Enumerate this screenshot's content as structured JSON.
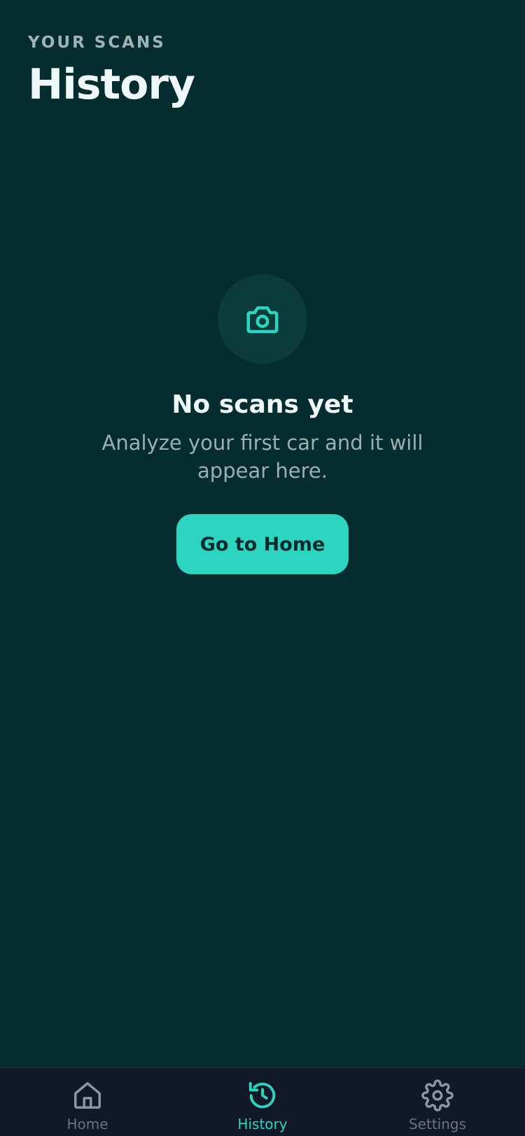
{
  "header": {
    "eyebrow": "YOUR SCANS",
    "title": "History"
  },
  "empty_state": {
    "icon": "camera-icon",
    "title": "No scans yet",
    "description": "Analyze your first car and it will appear here.",
    "button_label": "Go to Home"
  },
  "tabbar": {
    "active": "History",
    "items": [
      {
        "label": "Home",
        "icon": "home-icon"
      },
      {
        "label": "History",
        "icon": "history-icon"
      },
      {
        "label": "Settings",
        "icon": "gear-icon"
      }
    ]
  },
  "colors": {
    "background": "#052c2e",
    "accent": "#2dd4bf",
    "tabbar": "#111827",
    "muted_text": "#9db0b1"
  }
}
